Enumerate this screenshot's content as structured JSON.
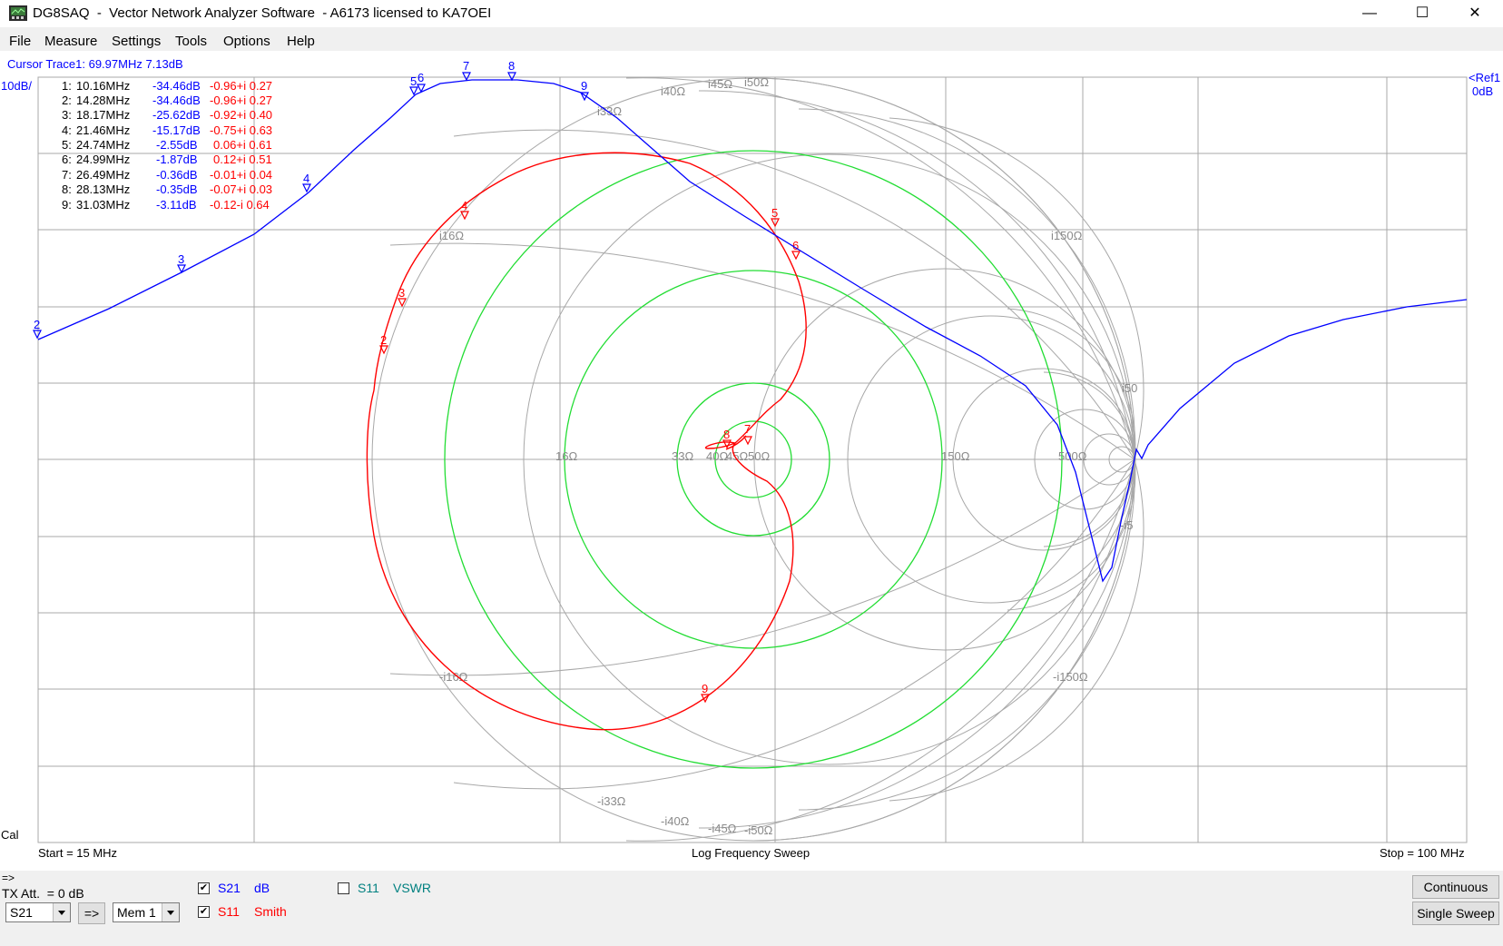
{
  "window": {
    "title": "DG8SAQ  -  Vector Network Analyzer Software  - A6173 licensed to KA7OEI",
    "minimize_glyph": "—",
    "maximize_glyph": "☐",
    "close_glyph": "✕"
  },
  "menu": [
    {
      "label": "File"
    },
    {
      "label": "Measure"
    },
    {
      "label": "Settings"
    },
    {
      "label": "Tools"
    },
    {
      "label": "Options"
    },
    {
      "label": "Help"
    }
  ],
  "plot": {
    "cursor_label": "Cursor Trace1:  69.97MHz      7.13dB",
    "scale_label": "10dB/",
    "ref_label_1": "<Ref1",
    "ref_label_2": "0dB",
    "cal_label": "Cal",
    "start_label": "Start = 15 MHz",
    "sweep_label": "Log Frequency Sweep",
    "stop_label": "Stop = 100 MHz",
    "colors": {
      "s21": "#0000ff",
      "s11": "#ff0000",
      "grid": "#a0a0a0",
      "vswr": "#00cc00"
    },
    "markers": [
      {
        "id": "1:",
        "freq": "10.16MHz",
        "db": "-34.46dB",
        "z": "-0.96+i 0.27"
      },
      {
        "id": "2:",
        "freq": "14.28MHz",
        "db": "-34.46dB",
        "z": "-0.96+i 0.27"
      },
      {
        "id": "3:",
        "freq": "18.17MHz",
        "db": "-25.62dB",
        "z": "-0.92+i 0.40"
      },
      {
        "id": "4:",
        "freq": "21.46MHz",
        "db": "-15.17dB",
        "z": "-0.75+i 0.63"
      },
      {
        "id": "5:",
        "freq": "24.74MHz",
        "db": "-2.55dB",
        "z": "0.06+i 0.61"
      },
      {
        "id": "6:",
        "freq": "24.99MHz",
        "db": "-1.87dB",
        "z": "0.12+i 0.51"
      },
      {
        "id": "7:",
        "freq": "26.49MHz",
        "db": "-0.36dB",
        "z": "-0.01+i 0.04"
      },
      {
        "id": "8:",
        "freq": "28.13MHz",
        "db": "-0.35dB",
        "z": "-0.07+i 0.03"
      },
      {
        "id": "9:",
        "freq": "31.03MHz",
        "db": "-3.11dB",
        "z": "-0.12-i 0.64"
      }
    ],
    "smith_labels": [
      "i40Ω",
      "i45Ω",
      "i50Ω",
      "i33Ω",
      "i16Ω",
      "i150Ω",
      "i50",
      "16Ω",
      "33Ω",
      "40Ω",
      "45Ω",
      "50Ω",
      "150Ω",
      "500Ω",
      "-i5",
      "-i16Ω",
      "-i150Ω",
      "-i33Ω",
      "-i40Ω",
      "-i45Ω",
      "-i50Ω"
    ],
    "s21_marker_labels": [
      "2",
      "3",
      "4",
      "5",
      "6",
      "7",
      "8",
      "9"
    ],
    "s11_marker_labels": [
      "2",
      "3",
      "4",
      "5",
      "6",
      "7",
      "8",
      "9"
    ]
  },
  "bottom": {
    "arrow_label": "=>",
    "tx_att": "TX Att.  = 0 dB",
    "param_combo": "S21",
    "copy_button": "=>",
    "mem_combo": "Mem 1",
    "trace1_param": "S21",
    "trace1_format": "dB",
    "trace2_param": "S11",
    "trace2_format": "Smith",
    "trace3_param": "S11",
    "trace3_format": "VSWR",
    "continuous_button": "Continuous",
    "single_sweep_button": "Single Sweep",
    "check_mark": "✔"
  }
}
